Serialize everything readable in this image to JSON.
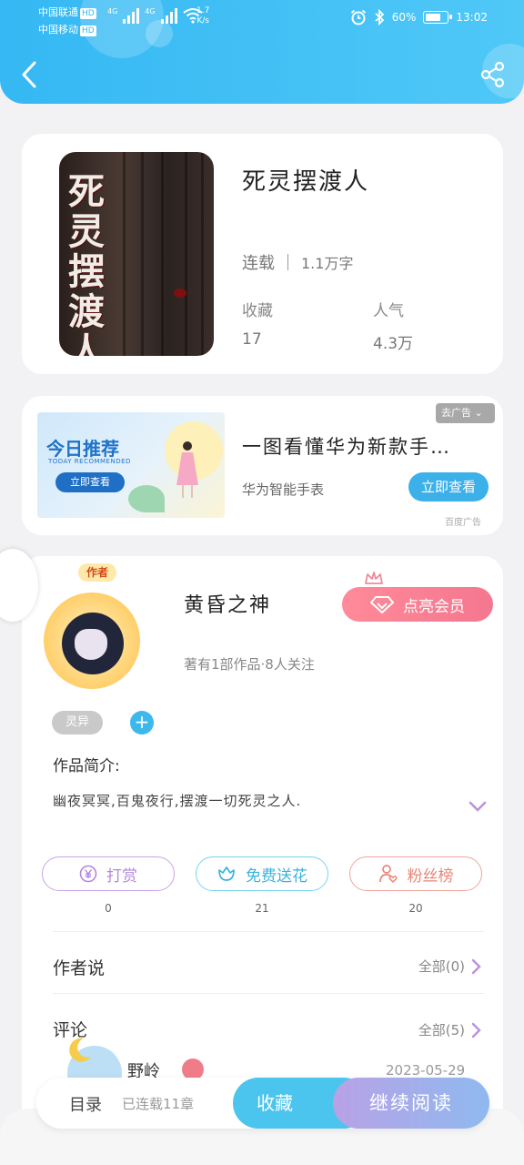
{
  "status_bar": {
    "carrier1": "中国联通",
    "carrier2": "中国移动",
    "hd": "HD",
    "net1": "4G",
    "net2": "4G",
    "speed_value": "1.7",
    "speed_unit": "K/s",
    "battery": "60%",
    "time": "13:02"
  },
  "book": {
    "cover_title": "死灵摆渡人",
    "title": "死灵摆渡人",
    "status": "连载",
    "word_count": "1.1万字",
    "favorites_label": "收藏",
    "favorites_value": "17",
    "popularity_label": "人气",
    "popularity_value": "4.3万"
  },
  "ad": {
    "image_heading": "今日推荐",
    "image_subheading": "TODAY RECOMMENDED",
    "image_cta": "立即查看",
    "title": "一图看懂华为新款手…",
    "subtitle": "华为智能手表",
    "button": "立即查看",
    "tag": "去广告",
    "source": "百度广告"
  },
  "author": {
    "badge": "作者",
    "name": "黄昏之神",
    "stats": "著有1部作品·8人关注",
    "vip_button": "点亮会员",
    "tag": "灵异",
    "add_tag": "+",
    "intro_label": "作品简介:",
    "intro_text": "幽夜冥冥,百鬼夜行,摆渡一切死灵之人.",
    "actions": [
      {
        "label": "打赏",
        "count": "0"
      },
      {
        "label": "免费送花",
        "count": "21"
      },
      {
        "label": "粉丝榜",
        "count": "20"
      }
    ],
    "author_says_label": "作者说",
    "author_says_all": "全部(0)",
    "comments_label": "评论",
    "comments_all": "全部(5)",
    "commenter_name": "野岭",
    "comment_date": "2023-05-29"
  },
  "bottom_bar": {
    "toc": "目录",
    "toc_status": "已连载11章",
    "favorite": "收藏",
    "continue": "继续阅读"
  }
}
